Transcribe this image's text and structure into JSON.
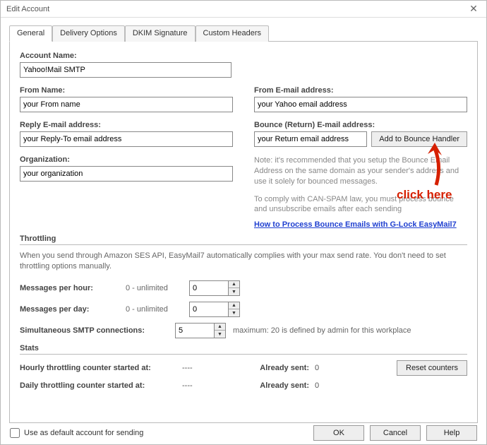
{
  "window": {
    "title": "Edit Account"
  },
  "tabs": {
    "general": "General",
    "delivery": "Delivery Options",
    "dkim": "DKIM Signature",
    "headers": "Custom Headers"
  },
  "fields": {
    "account_name": {
      "label": "Account Name:",
      "value": "Yahoo!Mail SMTP"
    },
    "from_name": {
      "label": "From Name:",
      "value": "your From name"
    },
    "from_email": {
      "label": "From E-mail address:",
      "value": "your Yahoo email address"
    },
    "reply_email": {
      "label": "Reply E-mail address:",
      "value": "your Reply-To email address"
    },
    "bounce_email": {
      "label": "Bounce (Return) E-mail address:",
      "value": "your Return email address"
    },
    "bounce_button": "Add to Bounce Handler",
    "organization": {
      "label": "Organization:",
      "value": "your organization"
    }
  },
  "notes": {
    "bounce1": "Note: it's recommended that you setup the Bounce Email Address on the same domain as your sender's address and use it solely for bounced messages.",
    "bounce2": "To comply with CAN-SPAM law, you must process bounce and unsubscribe emails after each sending",
    "link": "How to Process Bounce Emails with G-Lock EasyMail7"
  },
  "throttling": {
    "title": "Throttling",
    "desc": "When you send through Amazon SES API, EasyMail7 automatically complies with your max send rate. You don't need to set throttling options manually.",
    "msg_hour": {
      "label": "Messages per hour:",
      "hint": "0 - unlimited",
      "value": "0"
    },
    "msg_day": {
      "label": "Messages per day:",
      "hint": "0 - unlimited",
      "value": "0"
    },
    "smtp_conn": {
      "label": "Simultaneous SMTP connections:",
      "value": "5",
      "max_note": "maximum: 20 is defined by admin for this workplace"
    }
  },
  "stats": {
    "title": "Stats",
    "hourly": {
      "label": "Hourly throttling counter started at:",
      "value": "----",
      "already_label": "Already sent:",
      "already_value": "0"
    },
    "daily": {
      "label": "Daily throttling counter started at:",
      "value": "----",
      "already_label": "Already sent:",
      "already_value": "0"
    },
    "reset_btn": "Reset counters"
  },
  "footer": {
    "default_chk": "Use as default account for sending",
    "ok": "OK",
    "cancel": "Cancel",
    "help": "Help"
  },
  "annotation": {
    "text": "click here"
  }
}
